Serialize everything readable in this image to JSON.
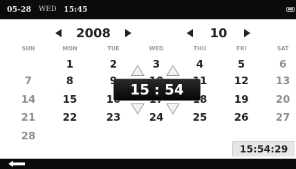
{
  "status_bar": {
    "date": "05-28",
    "weekday": "WED",
    "time": "15:45",
    "battery_icon": "battery-icon"
  },
  "year_nav": {
    "value": "2008"
  },
  "month_nav": {
    "value": "10"
  },
  "weekdays": [
    "SUN",
    "MON",
    "TUE",
    "WED",
    "THU",
    "FRI",
    "SAT"
  ],
  "calendar": {
    "rows": [
      [
        "",
        "1",
        "2",
        "3",
        "4",
        "5",
        "6"
      ],
      [
        "7",
        "8",
        "9",
        "10",
        "11",
        "12",
        "13"
      ],
      [
        "14",
        "15",
        "16",
        "17",
        "18",
        "19",
        "20"
      ],
      [
        "21",
        "22",
        "23",
        "24",
        "25",
        "26",
        "27"
      ],
      [
        "28",
        "",
        "",
        "",
        "",
        "",
        ""
      ]
    ]
  },
  "time_picker": {
    "display": "15 : 54"
  },
  "clock": {
    "time": "15:54:29"
  },
  "bottom_bar": {
    "back_icon": "back-arrow-icon"
  },
  "colors": {
    "bar_bg": "#0b0b0b",
    "weekend_text": "#8f8f8f",
    "text": "#222222"
  }
}
